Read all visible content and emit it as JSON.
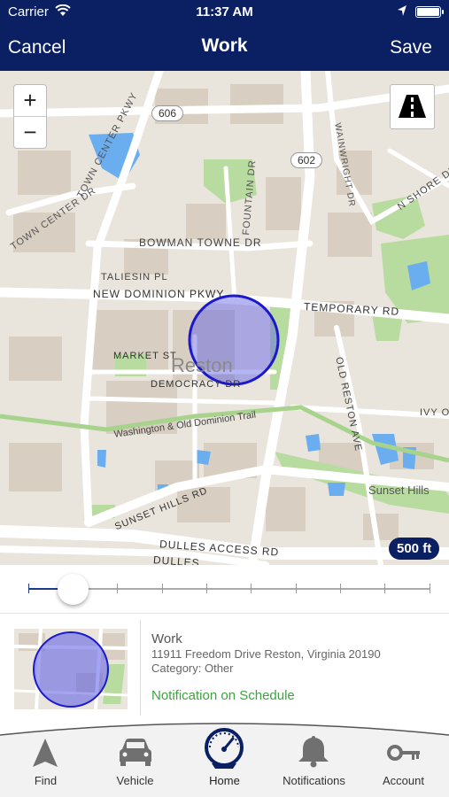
{
  "status_bar": {
    "carrier": "Carrier",
    "time": "11:37 AM"
  },
  "nav": {
    "cancel_label": "Cancel",
    "title": "Work",
    "save_label": "Save"
  },
  "map": {
    "zoom_in": "+",
    "zoom_out": "−",
    "scale": "500 ft",
    "city_label": "Reston",
    "road_labels": {
      "r606": "606",
      "r602": "602",
      "town_center_pkwy": "TOWN CENTER PKWY",
      "town_center_dr": "TOWN CENTER DR",
      "bowman_towne_dr": "BOWMAN TOWNE DR",
      "taliesin_pl": "TALIESIN PL",
      "new_dominion_pkwy": "NEW DOMINION PKWY",
      "temporary_rd": "TEMPORARY RD",
      "fountain_dr": "FOUNTAIN DR",
      "market_st": "MARKET ST",
      "democracy_dr": "DEMOCRACY DR",
      "wainwright_dr": "WAINWRIGHT DR",
      "n_shore_dr": "N SHORE DR",
      "old_reston_ave": "OLD RESTON AVE",
      "ivy_oak": "IVY OA",
      "washington_trail": "Washington & Old Dominion Trail",
      "sunset_hills_rd": "SUNSET HILLS RD",
      "sunset_hills": "Sunset Hills",
      "dulles_access_rd": "DULLES ACCESS RD",
      "dulles_2": "DULLES"
    },
    "accent_color": "#0b1f63",
    "geofence_color": "#1a1acc"
  },
  "radius_slider": {
    "position_fraction": 0.1,
    "tick_count": 10
  },
  "place": {
    "name": "Work",
    "address": "11911 Freedom Drive Reston, Virginia 20190",
    "category": "Category: Other",
    "notification": "Notification on Schedule"
  },
  "tabs": [
    {
      "label": "Find",
      "icon": "navigation-arrow-icon"
    },
    {
      "label": "Vehicle",
      "icon": "car-icon"
    },
    {
      "label": "Home",
      "icon": "speedometer-icon",
      "active": true
    },
    {
      "label": "Notifications",
      "icon": "bell-icon"
    },
    {
      "label": "Account",
      "icon": "key-icon"
    }
  ]
}
